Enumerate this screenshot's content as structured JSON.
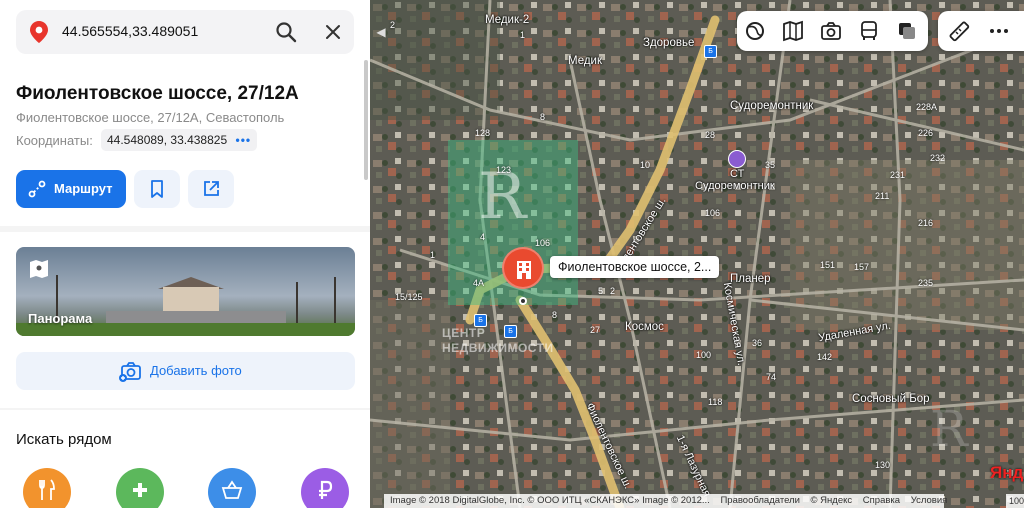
{
  "search": {
    "query": "44.565554,33.489051",
    "search_icon": "search-icon",
    "clear_icon": "close-icon"
  },
  "place": {
    "title": "Фиолентовское шоссе, 27/12А",
    "address": "Фиолентовское шоссе, 27/12А, Севастополь",
    "coords_label": "Координаты:",
    "coords_value": "44.548089, 33.438825",
    "coords_more": "•••"
  },
  "actions": {
    "route_label": "Маршрут",
    "bookmark_icon": "bookmark-icon",
    "share_icon": "share-icon"
  },
  "panorama": {
    "label": "Панорама"
  },
  "add_photo": {
    "label": "Добавить фото"
  },
  "nearby": {
    "title": "Искать рядом",
    "categories": [
      {
        "name": "food",
        "icon": "fork-knife-icon",
        "color": "#f2932d"
      },
      {
        "name": "pharmacy",
        "icon": "plus-icon",
        "color": "#5cb85c"
      },
      {
        "name": "shop",
        "icon": "basket-icon",
        "color": "#3d8ee8"
      },
      {
        "name": "atm",
        "icon": "ruble-icon",
        "color": "#9b5de5"
      }
    ]
  },
  "map": {
    "callout": "Фиолентовское шоссе, 2...",
    "labels": {
      "medik2": "Медик-2",
      "medik": "Медик",
      "zdorovye": "Здоровье",
      "sudoremontnik": "Судоремонтник",
      "st": "СТ",
      "st_sudoremontnik": "Судоремонтник",
      "planer": "Планер",
      "kosmos": "Космос",
      "udalennaya": "Удаленная ул.",
      "sosnovy_bor": "Сосновый Бор",
      "fiolent_road_1": "Фиолентовское ш.",
      "fiolent_road_2": "Фиолентовское ш.",
      "kosmicheskaya": "Космическая ул.",
      "lazurnaya": "1-я Лазурная"
    },
    "watermark": [
      "ЦЕНТР",
      "НЕДВИЖИМОСТИ"
    ],
    "numbers": [
      "128",
      "8",
      "1",
      "123",
      "2",
      "4",
      "118",
      "106",
      "106",
      "8",
      "15/125",
      "1",
      "4А",
      "2",
      "5",
      "27",
      "100",
      "74",
      "36",
      "142",
      "151",
      "157",
      "226",
      "231",
      "232",
      "211",
      "228А",
      "216",
      "235",
      "130",
      "35",
      "28",
      "10"
    ],
    "toolbar_icons": [
      "layers-icon",
      "book-map-icon",
      "camera-icon",
      "bus-icon",
      "copy-layers-icon"
    ],
    "toolbar2_icons": [
      "ruler-icon",
      "more-icon"
    ],
    "attribution": {
      "img1": "Image © 2018 DigitalGlobe, Inc. © ООО ИТЦ «СКАНЭКС» Image © 2012...",
      "rights": "Правообладатели",
      "yandex": "© Яндекс",
      "help": "Справка",
      "terms": "Условия",
      "logo_prefix": "Янд",
      "scale": "100"
    }
  }
}
